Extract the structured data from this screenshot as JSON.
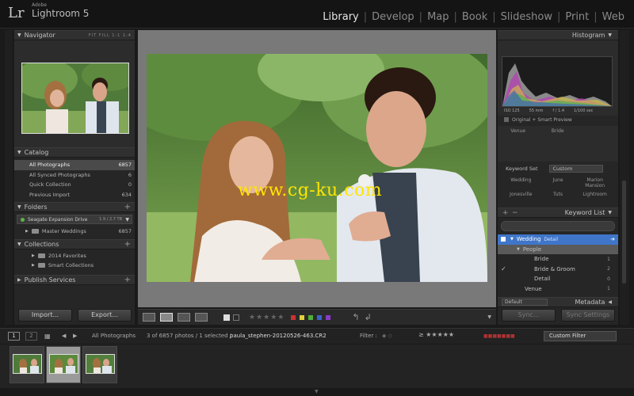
{
  "app": {
    "logo": "Lr",
    "adobe": "Adobe",
    "product": "Lightroom 5"
  },
  "modules": [
    "Library",
    "Develop",
    "Map",
    "Book",
    "Slideshow",
    "Print",
    "Web"
  ],
  "navigator": {
    "title": "Navigator",
    "options": "FIT  FILL  1:1  1:4"
  },
  "catalog": {
    "title": "Catalog",
    "items": [
      {
        "label": "All Photographs",
        "count": "6857"
      },
      {
        "label": "All Synced Photographs",
        "count": "6"
      },
      {
        "label": "Quick Collection",
        "count": "0"
      },
      {
        "label": "Previous Import",
        "count": "634"
      }
    ]
  },
  "folders": {
    "title": "Folders",
    "drive": "Seagate Expansion Drive",
    "drive_size": "1.9 / 2.7 TB",
    "items": [
      {
        "label": "Master Weddings",
        "count": "6857"
      }
    ]
  },
  "collections": {
    "title": "Collections",
    "items": [
      {
        "label": "2014 Favorites"
      },
      {
        "label": "Smart Collections"
      }
    ]
  },
  "publish": {
    "title": "Publish Services"
  },
  "buttons": {
    "import": "Import...",
    "export": "Export...",
    "sync": "Sync...",
    "sync_settings": "Sync Settings"
  },
  "watermark": "www.cg-ku.com",
  "histogram": {
    "title": "Histogram",
    "iso": "ISO 125",
    "focal": "55 mm",
    "aperture": "f / 1.4",
    "shutter": "1/100 sec",
    "preview": "Original + Smart Preview"
  },
  "keywords_top": [
    "Venue",
    "Bride"
  ],
  "keyword_set": {
    "label": "Keyword Set",
    "value": "Custom",
    "grid": [
      "Wedding",
      "June",
      "Marion Mansion",
      "Jonesville",
      "Tuts",
      "Lightroom"
    ]
  },
  "keyword_list": {
    "title": "Keyword List",
    "items": [
      {
        "label": "Wedding",
        "extra": "Detail",
        "indent": 0
      },
      {
        "label": "People",
        "indent": 1
      },
      {
        "label": "Bride",
        "count": "1",
        "indent": 2
      },
      {
        "label": "Bride & Groom",
        "count": "2",
        "indent": 2
      },
      {
        "label": "Detail",
        "count": "0",
        "indent": 2
      },
      {
        "label": "Venue",
        "count": "1",
        "indent": 1
      }
    ]
  },
  "metadata": {
    "title": "Metadata",
    "preset": "Default"
  },
  "filterbar": {
    "page1": "1",
    "page2": "2",
    "source": "All Photographs",
    "info": "3 of 6857 photos / 1 selected /",
    "filename": "paula_stephen-20120526-463.CR2",
    "filter_label": "Filter :",
    "custom_filter": "Custom Filter"
  },
  "colors": {
    "accent_blue": "#3f76c9",
    "watermark": "#ffe500",
    "swatches": [
      "#c83232",
      "#e0d23a",
      "#4fae3a",
      "#3a64c8",
      "#8a3ac8"
    ]
  }
}
